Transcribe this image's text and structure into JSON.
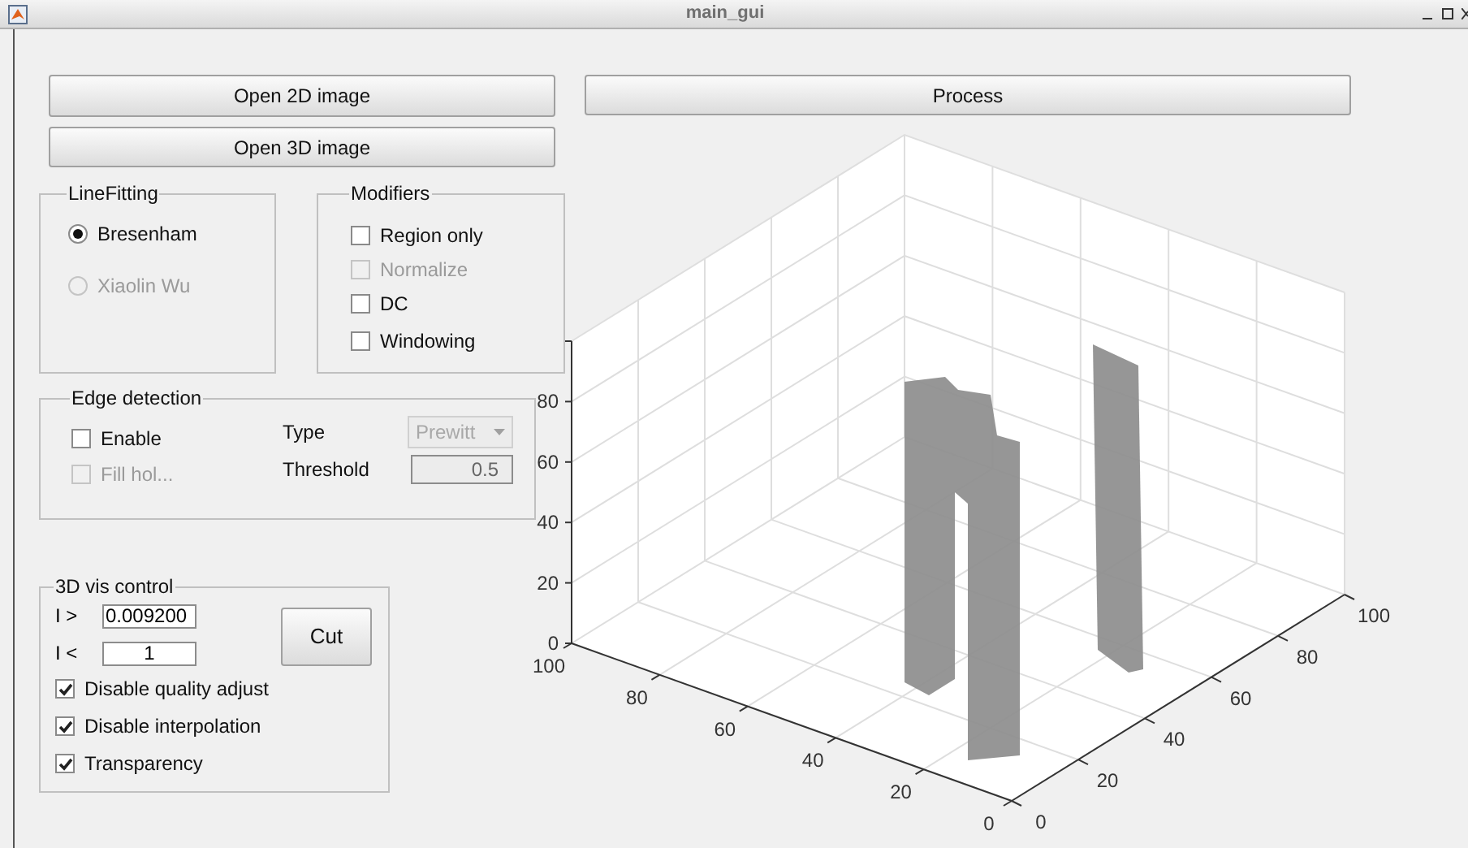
{
  "window": {
    "title": "main_gui"
  },
  "buttons": {
    "open_2d": "Open 2D image",
    "open_3d": "Open 3D image",
    "process": "Process"
  },
  "line_fitting": {
    "title": "LineFitting",
    "options": [
      {
        "label": "Bresenham",
        "selected": true,
        "disabled": false
      },
      {
        "label": "Xiaolin Wu",
        "selected": false,
        "disabled": true
      }
    ]
  },
  "modifiers": {
    "title": "Modifiers",
    "items": [
      {
        "label": "Region only",
        "checked": false,
        "disabled": false
      },
      {
        "label": "Normalize",
        "checked": false,
        "disabled": true
      },
      {
        "label": "DC",
        "checked": false,
        "disabled": false
      },
      {
        "label": "Windowing",
        "checked": false,
        "disabled": false
      }
    ]
  },
  "edge_detection": {
    "title": "Edge detection",
    "enable": {
      "label": "Enable",
      "checked": false,
      "disabled": false
    },
    "fill_holes": {
      "label": "Fill hol...",
      "checked": false,
      "disabled": true
    },
    "type": {
      "label": "Type",
      "value": "Prewitt",
      "disabled": true
    },
    "threshold": {
      "label": "Threshold",
      "value": "0.5",
      "disabled": true
    }
  },
  "vis_control": {
    "title": "3D vis control",
    "lower": {
      "label": "I >",
      "value": "0.009200"
    },
    "upper": {
      "label": "I <",
      "value": "1"
    },
    "cut_button": "Cut",
    "options": [
      {
        "label": "Disable quality adjust",
        "checked": true
      },
      {
        "label": "Disable interpolation",
        "checked": true
      },
      {
        "label": "Transparency",
        "checked": true
      }
    ]
  },
  "plot": {
    "z_ticks": [
      "80",
      "60",
      "40",
      "20",
      "0"
    ],
    "x_ticks": [
      "100",
      "80",
      "60",
      "40",
      "20",
      "0"
    ],
    "y_ticks": [
      "0",
      "20",
      "40",
      "60",
      "80",
      "100"
    ]
  }
}
